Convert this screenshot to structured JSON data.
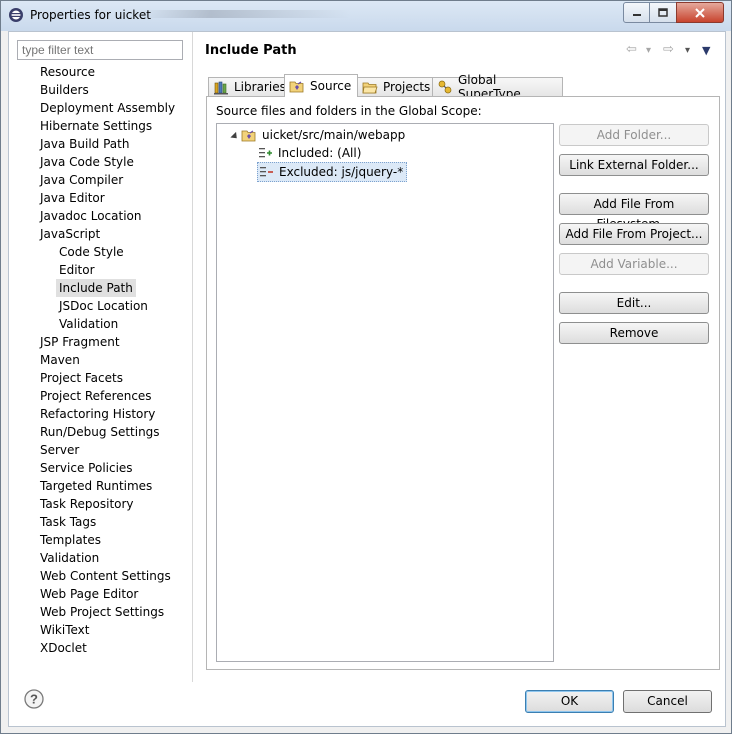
{
  "window": {
    "title": "Properties for uicket"
  },
  "filter": {
    "placeholder": "type filter text"
  },
  "nav": {
    "items": [
      {
        "label": "Resource",
        "indent": 0
      },
      {
        "label": "Builders",
        "indent": 0
      },
      {
        "label": "Deployment Assembly",
        "indent": 0
      },
      {
        "label": "Hibernate Settings",
        "indent": 0
      },
      {
        "label": "Java Build Path",
        "indent": 0
      },
      {
        "label": "Java Code Style",
        "indent": 0
      },
      {
        "label": "Java Compiler",
        "indent": 0
      },
      {
        "label": "Java Editor",
        "indent": 0
      },
      {
        "label": "Javadoc Location",
        "indent": 0
      },
      {
        "label": "JavaScript",
        "indent": 0
      },
      {
        "label": "Code Style",
        "indent": 1
      },
      {
        "label": "Editor",
        "indent": 1
      },
      {
        "label": "Include Path",
        "indent": 1,
        "selected": true
      },
      {
        "label": "JSDoc Location",
        "indent": 1
      },
      {
        "label": "Validation",
        "indent": 1
      },
      {
        "label": "JSP Fragment",
        "indent": 0
      },
      {
        "label": "Maven",
        "indent": 0
      },
      {
        "label": "Project Facets",
        "indent": 0
      },
      {
        "label": "Project References",
        "indent": 0
      },
      {
        "label": "Refactoring History",
        "indent": 0
      },
      {
        "label": "Run/Debug Settings",
        "indent": 0
      },
      {
        "label": "Server",
        "indent": 0
      },
      {
        "label": "Service Policies",
        "indent": 0
      },
      {
        "label": "Targeted Runtimes",
        "indent": 0
      },
      {
        "label": "Task Repository",
        "indent": 0
      },
      {
        "label": "Task Tags",
        "indent": 0
      },
      {
        "label": "Templates",
        "indent": 0
      },
      {
        "label": "Validation",
        "indent": 0
      },
      {
        "label": "Web Content Settings",
        "indent": 0
      },
      {
        "label": "Web Page Editor",
        "indent": 0
      },
      {
        "label": "Web Project Settings",
        "indent": 0
      },
      {
        "label": "WikiText",
        "indent": 0
      },
      {
        "label": "XDoclet",
        "indent": 0
      }
    ]
  },
  "page": {
    "title": "Include Path"
  },
  "history": {
    "back": "⇦",
    "forward": "⇨",
    "dropdown": "▾",
    "menu": "▼"
  },
  "tabs": [
    {
      "label": "Libraries",
      "icon": "library-icon"
    },
    {
      "label": "Source",
      "icon": "source-folder-icon",
      "active": true
    },
    {
      "label": "Projects",
      "icon": "project-folder-icon"
    },
    {
      "label": "Global SuperType",
      "icon": "supertype-icon"
    }
  ],
  "source": {
    "scope_label": "Source files and folders in the Global Scope:",
    "tree": [
      {
        "label": "uicket/src/main/webapp",
        "level": 0,
        "icon": "source-folder-icon",
        "expanded": true
      },
      {
        "label": "Included: (All)",
        "level": 1,
        "icon": "inclusion-filter-icon"
      },
      {
        "label": "Excluded: js/jquery-*",
        "level": 1,
        "icon": "exclusion-filter-icon",
        "selected": true
      }
    ]
  },
  "buttons": {
    "add_folder": "Add Folder...",
    "link_external_folder": "Link External Folder...",
    "add_file_from_filesystem": "Add File From Filesystem...",
    "add_file_from_project": "Add File From Project...",
    "add_variable": "Add Variable...",
    "edit": "Edit...",
    "remove": "Remove"
  },
  "footer": {
    "help": "?",
    "ok": "OK",
    "cancel": "Cancel"
  }
}
